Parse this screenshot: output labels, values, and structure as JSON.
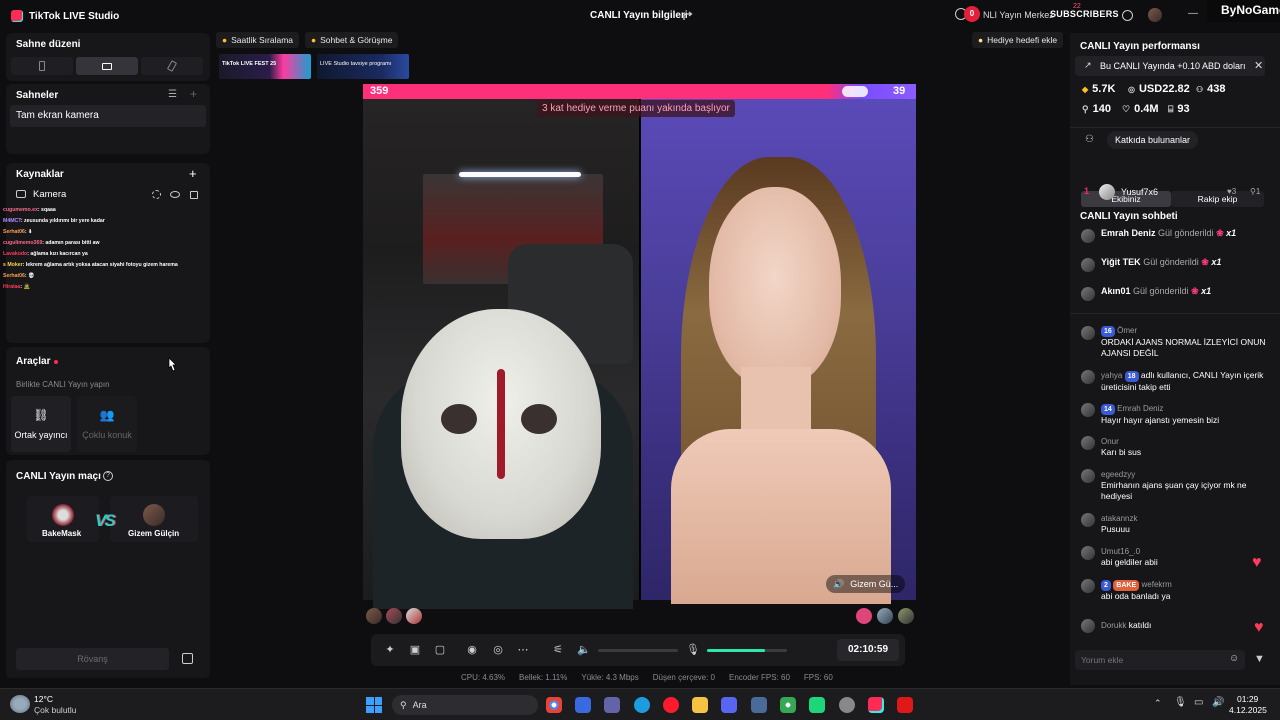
{
  "app": {
    "name": "TikTok LIVE Studio",
    "center_title": "CANLI Yayın bilgileri"
  },
  "header_right": {
    "badge": "0",
    "merkez": "NLI Yayın Merkez",
    "subscribers": "SUBSCRIBERS",
    "sub_count": "22",
    "bynogame": "ByNoGame"
  },
  "left": {
    "scene_layout_title": "Sahne düzeni",
    "scenes_title": "Sahneler",
    "scene_item": "Tam ekran kamera",
    "sources_title": "Kaynaklar",
    "source_item": "Kamera",
    "chat_overlay": [
      {
        "user": "cugumemo.ex",
        "text": ": sqaaa"
      },
      {
        "user": "M4MCT",
        "text": ": zeusunda yıldırımı bir yere kadar"
      },
      {
        "user": "Serhat06",
        "text": ": ⬇"
      },
      {
        "user": "cugulimemo369",
        "text": ": adamın parası bitti aw"
      },
      {
        "user": "Lavakodo",
        "text": ": ağlama kızı kacırcan ya"
      },
      {
        "user": "s Moker",
        "text": ": lekrem ağlama artık yoksa atacan siyahi fotoyu gizem harema"
      },
      {
        "user": "Serhat06",
        "text": ": 💀"
      },
      {
        "user": "Hiralaa",
        "text": ": 🧟"
      }
    ],
    "tools_title": "Araçlar",
    "tools_sub": "Birlikte CANLI Yayın yapın",
    "tool_cohost": "Ortak yayıncı",
    "tool_multi": "Çoklu konuk",
    "match_title": "CANLI Yayın maçı",
    "vs": "VS",
    "player1": "BakeMask",
    "player2": "Gizem Gülçin",
    "rematch": "Rövanş"
  },
  "center": {
    "chip1": "Saatlik Sıralama",
    "chip2": "Sohbet & Görüşme",
    "gift_goal": "Hediye hedefi ekle",
    "banner_a": "TikTok LIVE FEST 25",
    "banner_b": "LIVE Studio tavsiye programı",
    "score_left": "359",
    "score_right": "39",
    "pk_notice": "3 kat hediye verme puanı yakında başlıyor",
    "right_name": "Gizem Gü...",
    "timer": "02:10:59",
    "stats": [
      "CPU: 4.63%",
      "Bellek: 1.11%",
      "Yükle: 4.3 Mbps",
      "Düşen çerçeve: 0",
      "Encoder FPS: 60",
      "FPS: 60"
    ]
  },
  "right": {
    "perf_title": "CANLI Yayın performansı",
    "promo": "Bu CANLI Yayında +0.10 ABD doları",
    "stat_likes": "5.7K",
    "stat_usd": "USD22.82",
    "stat_viewers": "438",
    "stat_followers": "140",
    "stat_hearts": "0.4M",
    "stat_gifts": "93",
    "contributors": "Katkıda bulunanlar",
    "tab_us": "Ekibiniz",
    "tab_rival": "Rakip ekip",
    "rank_num": "1",
    "rank_user": "Yusuf7x6",
    "rank_hearts": "3",
    "rank_count": "1",
    "chat_title": "CANLI Yayın sohbeti",
    "gifts": [
      {
        "user": "Emrah Deniz",
        "text": "Gül gönderildi",
        "x": "x1"
      },
      {
        "user": "Yiğit TEK",
        "text": "Gül gönderildi",
        "x": "x1"
      },
      {
        "user": "Akın01",
        "text": "Gül gönderildi",
        "x": "x1"
      }
    ],
    "messages": [
      {
        "user": "Ömer",
        "lvl": "16",
        "text": "ORDAKİ AJANS NORMAL İZLEYİCİ ONUN AJANSI DEĞİL"
      },
      {
        "user": "yahya",
        "lvl": "18",
        "text": "adlı kullanıcı, CANLI Yayın içerik üreticisini takip etti"
      },
      {
        "user": "Emrah Deniz",
        "lvl": "14",
        "text": "Hayır hayır ajanstı yemesin bizi"
      },
      {
        "user": "Onur",
        "lvl": "",
        "text": "Karı bi sus"
      },
      {
        "user": "egeedzyy",
        "lvl": "",
        "text": "Emirhanın ajans şuan çay içiyor mk ne hediyesi"
      },
      {
        "user": "atakannzk",
        "lvl": "",
        "text": "Pusuuu"
      },
      {
        "user": "Umut16_.0",
        "lvl": "",
        "text": "abi geldiler abii"
      },
      {
        "user": "wefekrm",
        "lvl": "2",
        "text": "abi oda banladı ya"
      },
      {
        "user": "Dorukk",
        "lvl": "",
        "text": "katıldı"
      }
    ],
    "input_placeholder": "Yorum ekle",
    "msg8_bake_tag": "BAKE"
  },
  "taskbar": {
    "temp": "12°C",
    "weather": "Çok bulutlu",
    "search": "Ara",
    "time": "01:29",
    "date": "4.12.2025"
  },
  "colors": {
    "accent": "#fe2c55",
    "cyan": "#25f4ee",
    "pk_pink": "#ff2f7a",
    "pk_purple": "#8b5cff"
  }
}
